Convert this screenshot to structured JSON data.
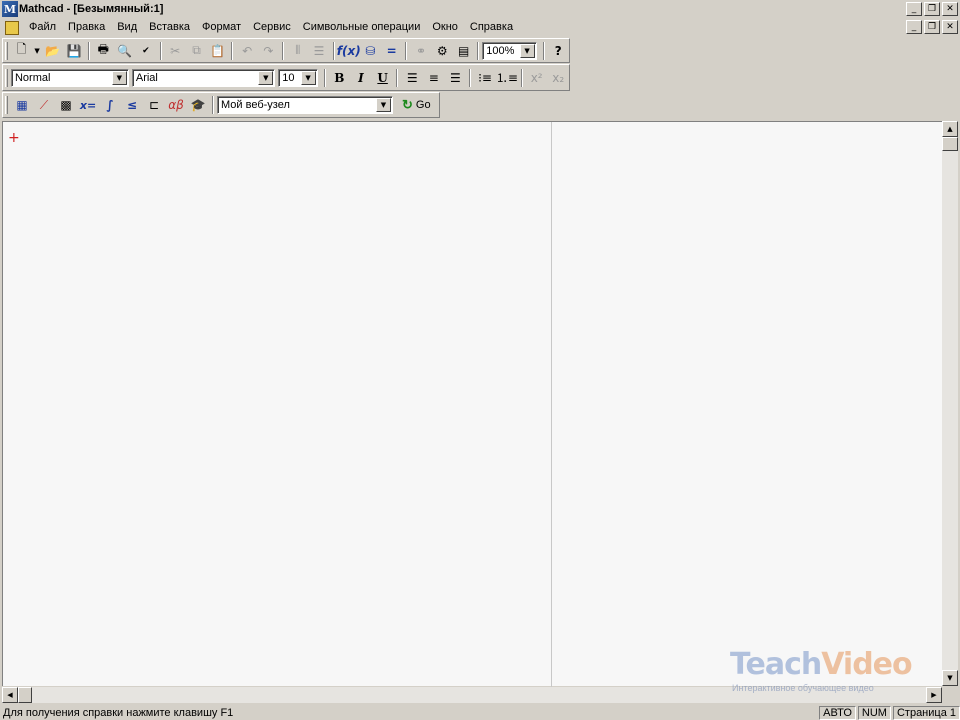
{
  "window": {
    "app_name": "Mathcad - [Безымянный:1]"
  },
  "menu": [
    "Файл",
    "Правка",
    "Вид",
    "Вставка",
    "Формат",
    "Сервис",
    "Символьные операции",
    "Окно",
    "Справка"
  ],
  "toolbar_standard": {
    "zoom": "100%"
  },
  "toolbar_format": {
    "style": "Normal",
    "font": "Arial",
    "size": "10"
  },
  "toolbar_math": {
    "web_location": "Мой веб-узел",
    "go_label": "Go"
  },
  "format_buttons": {
    "bold": "B",
    "italic": "I",
    "underline": "U"
  },
  "watermark": {
    "part1": "Teach",
    "part2": "Video",
    "subtitle": "Интерактивное обучающее видео"
  },
  "status": {
    "help_text": "Для получения справки нажмите клавишу F1",
    "mode": "АВТО",
    "num": "NUM",
    "page": "Страница 1"
  }
}
